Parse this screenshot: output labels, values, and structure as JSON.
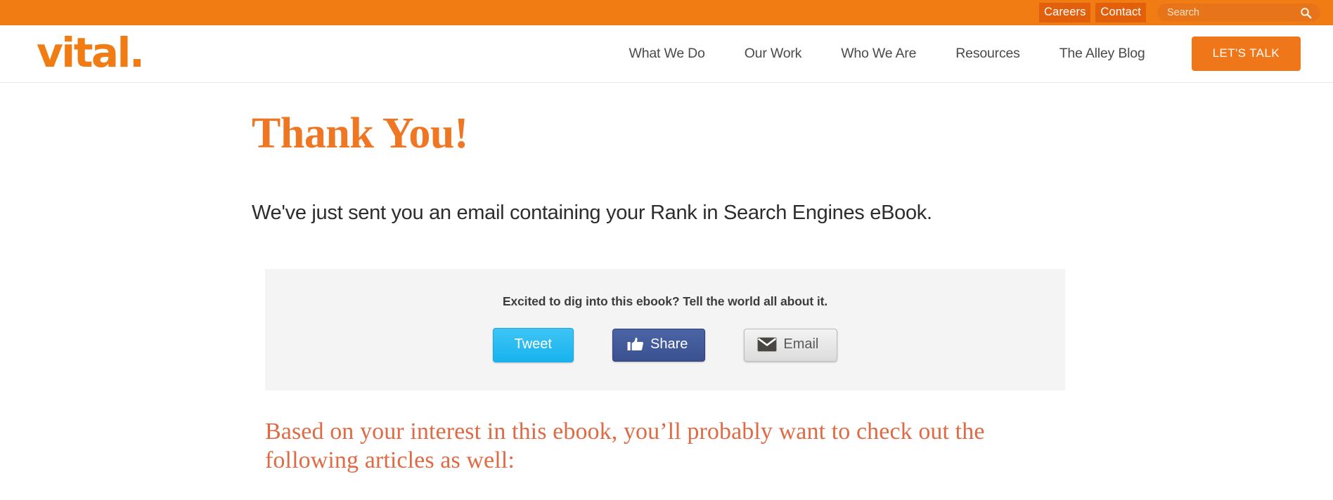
{
  "topbar": {
    "links": [
      {
        "label": "Careers",
        "name": "careers"
      },
      {
        "label": "Contact",
        "name": "contact"
      }
    ],
    "search": {
      "placeholder": "Search",
      "value": "",
      "icon": "search-icon"
    },
    "background_color": "#f07c13",
    "link_highlight_color": "#e2600b"
  },
  "header": {
    "logo": "vital.",
    "logo_color": "#f07c13",
    "nav": [
      {
        "label": "What We Do",
        "name": "what-we-do"
      },
      {
        "label": "Our Work",
        "name": "our-work"
      },
      {
        "label": "Who We Are",
        "name": "who-we-are"
      },
      {
        "label": "Resources",
        "name": "resources"
      },
      {
        "label": "The Alley Blog",
        "name": "the-alley-blog"
      }
    ],
    "cta": {
      "label": "LET'S TALK",
      "color": "#f0761a"
    }
  },
  "main": {
    "heading": "Thank You!",
    "heading_color": "#ef7622",
    "lead": "We've just sent you an email containing your Rank in Search Engines eBook.",
    "share": {
      "prompt": "Excited to dig into this ebook? Tell the world all about it.",
      "panel_background": "#f4f4f4",
      "buttons": [
        {
          "label": "Tweet",
          "name": "tweet",
          "icon": "",
          "color": "#1db2ed"
        },
        {
          "label": "Share",
          "name": "facebook-share",
          "icon": "thumbs-up-icon",
          "color": "#3b5190"
        },
        {
          "label": "Email",
          "name": "email-share",
          "icon": "envelope-icon",
          "color": "#e3e3e3"
        }
      ]
    },
    "outro": "Based on your interest in this ebook, you’ll probably want to check out the following articles as well:",
    "outro_color": "#df6a43"
  }
}
